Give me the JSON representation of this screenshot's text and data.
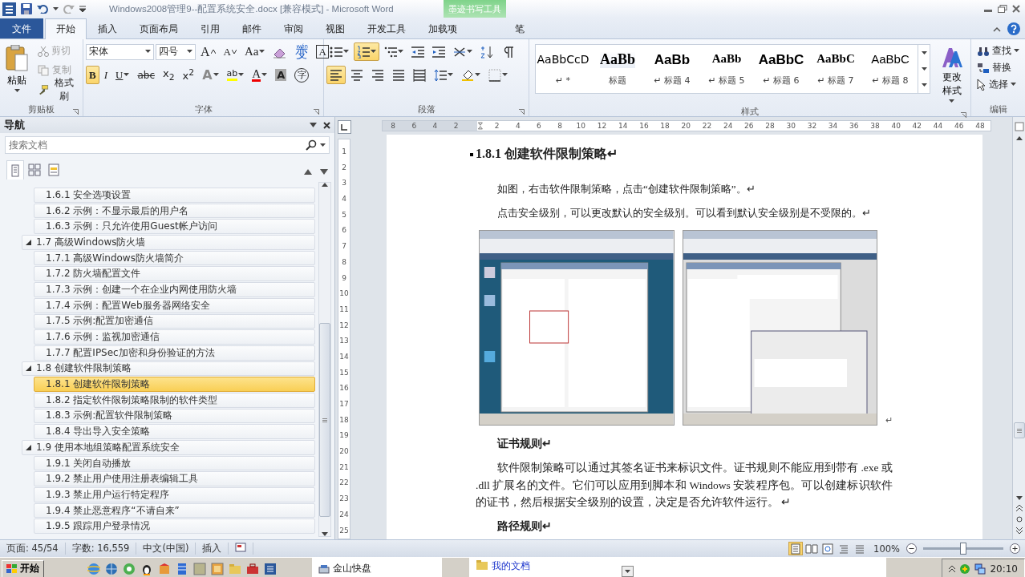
{
  "title_bar": {
    "title": "Windows2008管理9--配置系统安全.docx [兼容模式]  -  Microsoft Word",
    "contextual_group": "墨迹书写工具"
  },
  "tabs": [
    {
      "label": "文件",
      "kind": "file",
      "selected": false
    },
    {
      "label": "开始",
      "kind": "normal",
      "selected": true
    },
    {
      "label": "插入",
      "kind": "normal",
      "selected": false
    },
    {
      "label": "页面布局",
      "kind": "normal",
      "selected": false
    },
    {
      "label": "引用",
      "kind": "normal",
      "selected": false
    },
    {
      "label": "邮件",
      "kind": "normal",
      "selected": false
    },
    {
      "label": "审阅",
      "kind": "normal",
      "selected": false
    },
    {
      "label": "视图",
      "kind": "normal",
      "selected": false
    },
    {
      "label": "开发工具",
      "kind": "normal",
      "selected": false
    },
    {
      "label": "加载项",
      "kind": "normal",
      "selected": false
    },
    {
      "label": "笔",
      "kind": "contextual",
      "selected": false
    }
  ],
  "ribbon": {
    "clipboard": {
      "group": "剪贴板",
      "paste": "粘贴",
      "tools": [
        {
          "kind": "cut",
          "label": "剪切",
          "disabled": true
        },
        {
          "kind": "copy",
          "label": "复制",
          "disabled": true
        },
        {
          "kind": "painter",
          "label": "格式刷",
          "disabled": false
        }
      ]
    },
    "font": {
      "group": "字体",
      "name": "宋体",
      "size": "四号",
      "row1": [
        {
          "kind": "grow",
          "glyph": "A"
        },
        {
          "kind": "shrink",
          "glyph": "A"
        },
        {
          "kind": "case",
          "glyph": "Aa"
        },
        {
          "kind": "clear"
        },
        {
          "kind": "phonetic",
          "glyph": "变",
          "ruby": "wén"
        },
        {
          "kind": "border",
          "glyph": "A"
        }
      ],
      "row2": [
        {
          "kind": "bold",
          "glyph": "B",
          "selected": true
        },
        {
          "kind": "italic",
          "glyph": "I",
          "selected": false
        },
        {
          "kind": "underline",
          "glyph": "U",
          "selected": false
        },
        {
          "kind": "strike",
          "glyph": "abc",
          "selected": false
        },
        {
          "kind": "sub",
          "glyph": "x$_{2}$",
          "selected": false
        },
        {
          "kind": "sup",
          "glyph": "x$^{2}$",
          "selected": false
        },
        {
          "kind": "effects",
          "glyph": "A"
        },
        {
          "kind": "highlight",
          "glyph": "ab"
        },
        {
          "kind": "color",
          "glyph": "A"
        },
        {
          "kind": "shading",
          "glyph": "A"
        },
        {
          "kind": "enclose",
          "glyph": "字"
        }
      ]
    },
    "paragraph": {
      "group": "段落",
      "row1": [
        {
          "kind": "bullets",
          "selected": false
        },
        {
          "kind": "numbering",
          "selected": true
        },
        {
          "kind": "multilevel",
          "selected": false
        },
        {
          "kind": "outdent"
        },
        {
          "kind": "indent"
        },
        {
          "kind": "asian"
        },
        {
          "kind": "sort"
        },
        {
          "kind": "marks",
          "selected": false
        }
      ],
      "row2": [
        {
          "kind": "left",
          "selected": true
        },
        {
          "kind": "center",
          "selected": false
        },
        {
          "kind": "right",
          "selected": false
        },
        {
          "kind": "justify",
          "selected": false
        },
        {
          "kind": "distribute",
          "selected": false
        },
        {
          "kind": "spacing"
        },
        {
          "kind": "shading"
        },
        {
          "kind": "borders"
        }
      ]
    },
    "styles": {
      "group": "样式",
      "change": "更改样式",
      "items": [
        {
          "preview": "AaBbCcD",
          "label": "↵ *",
          "kind": "normal"
        },
        {
          "preview": "AaBb",
          "label": "标题",
          "kind": "title"
        },
        {
          "preview": "AaBb",
          "label": "↵ 标题 4",
          "kind": "sans"
        },
        {
          "preview": "AaBb",
          "label": "↵ 标题 5",
          "kind": "serif"
        },
        {
          "preview": "AaBbC",
          "label": "↵ 标题 6",
          "kind": "sans"
        },
        {
          "preview": "AaBbC",
          "label": "↵ 标题 7",
          "kind": "serif"
        },
        {
          "preview": "AaBbC",
          "label": "↵ 标题 8",
          "kind": "light"
        }
      ]
    },
    "editing": {
      "group": "编辑",
      "tools": [
        {
          "kind": "find",
          "label": "查找"
        },
        {
          "kind": "replace",
          "label": "替换"
        },
        {
          "kind": "select",
          "label": "选择"
        }
      ]
    }
  },
  "navigation": {
    "title": "导航",
    "search_placeholder": "搜索文档",
    "views": [
      {
        "kind": "headings",
        "selected": true
      },
      {
        "kind": "pages",
        "selected": false
      },
      {
        "kind": "results",
        "selected": false
      }
    ],
    "continued": [
      {
        "label": "1.6.1 安全选项设置",
        "selected": false
      },
      {
        "label": "1.6.2 示例：不显示最后的用户名",
        "selected": false
      },
      {
        "label": "1.6.3 示例：只允许使用Guest帐户访问",
        "selected": false
      }
    ],
    "sections": [
      {
        "label": "1.7 高级Windows防火墙",
        "expanded": true,
        "selected": false,
        "children": [
          {
            "label": "1.7.1 高级Windows防火墙简介",
            "selected": false
          },
          {
            "label": "1.7.2 防火墙配置文件",
            "selected": false
          },
          {
            "label": "1.7.3 示例：创建一个在企业内网使用防火墙",
            "selected": false
          },
          {
            "label": "1.7.4 示例：配置Web服务器网络安全",
            "selected": false
          },
          {
            "label": "1.7.5 示例:配置加密通信",
            "selected": false
          },
          {
            "label": "1.7.6 示例：监视加密通信",
            "selected": false
          },
          {
            "label": "1.7.7 配置IPSec加密和身份验证的方法",
            "selected": false
          }
        ]
      },
      {
        "label": "1.8 创建软件限制策略",
        "expanded": true,
        "selected": false,
        "children": [
          {
            "label": "1.8.1 创建软件限制策略",
            "selected": true
          },
          {
            "label": "1.8.2 指定软件限制策略限制的软件类型",
            "selected": false
          },
          {
            "label": "1.8.3 示例:配置软件限制策略",
            "selected": false
          },
          {
            "label": "1.8.4 导出导入安全策略",
            "selected": false
          }
        ]
      },
      {
        "label": "1.9 使用本地组策略配置系统安全",
        "expanded": true,
        "selected": false,
        "children": [
          {
            "label": "1.9.1 关闭自动播放",
            "selected": false
          },
          {
            "label": "1.9.2 禁止用户使用注册表编辑工具",
            "selected": false
          },
          {
            "label": "1.9.3 禁止用户运行特定程序",
            "selected": false
          },
          {
            "label": "1.9.4 禁止恶意程序“不请自来”",
            "selected": false
          },
          {
            "label": "1.9.5 跟踪用户登录情况",
            "selected": false
          }
        ]
      }
    ]
  },
  "ruler": {
    "left_ticks": [
      "8",
      "6",
      "4",
      "2"
    ],
    "right_ticks": [
      "2",
      "4",
      "6",
      "8",
      "10",
      "12",
      "14",
      "16",
      "18",
      "20",
      "22",
      "24",
      "26",
      "28",
      "30",
      "32",
      "34",
      "36",
      "38",
      "40",
      "42",
      "44",
      "46",
      "48"
    ],
    "vertical_ticks": [
      "1",
      "2",
      "3",
      "4",
      "5",
      "6",
      "7",
      "8",
      "9",
      "10",
      "11",
      "12",
      "13",
      "14",
      "15",
      "16",
      "17",
      "18",
      "19",
      "20",
      "21",
      "22",
      "23",
      "24",
      "25"
    ]
  },
  "document": [
    {
      "kind": "heading",
      "text": "1.8.1 创建软件限制策略↵"
    },
    {
      "kind": "para",
      "text": "如图，右击软件限制策略，点击“创建软件限制策略”。↵"
    },
    {
      "kind": "para",
      "text": "点击安全级别，可以更改默认的安全级别。可以看到默认安全级别是不受限的。↵"
    },
    {
      "kind": "figure",
      "mark": "↵"
    },
    {
      "kind": "subheading",
      "text": "证书规则↵"
    },
    {
      "kind": "body",
      "text": "软件限制策略可以通过其签名证书来标识文件。证书规则不能应用到带有 .exe 或 .dll 扩展名的文件。它们可以应用到脚本和 Windows 安装程序包。可以创建标识软件的证书，然后根据安全级别的设置，决定是否允许软件运行。 ↵"
    },
    {
      "kind": "subheading",
      "text": "路径规则↵"
    }
  ],
  "status_bar": {
    "page": "页面: 45/54",
    "words": "字数: 16,559",
    "language": "中文(中国)",
    "mode": "插入",
    "zoom": "100%",
    "zoom_slider": {
      "level": 0.5
    },
    "views": [
      {
        "kind": "print",
        "selected": true
      },
      {
        "kind": "reading",
        "selected": false
      },
      {
        "kind": "web",
        "selected": false
      },
      {
        "kind": "outline",
        "selected": false
      },
      {
        "kind": "draft",
        "selected": false
      }
    ]
  },
  "taskbar": {
    "start": "开始",
    "window": "金山快盘",
    "folder": "我的文档",
    "clock": "20:10"
  }
}
